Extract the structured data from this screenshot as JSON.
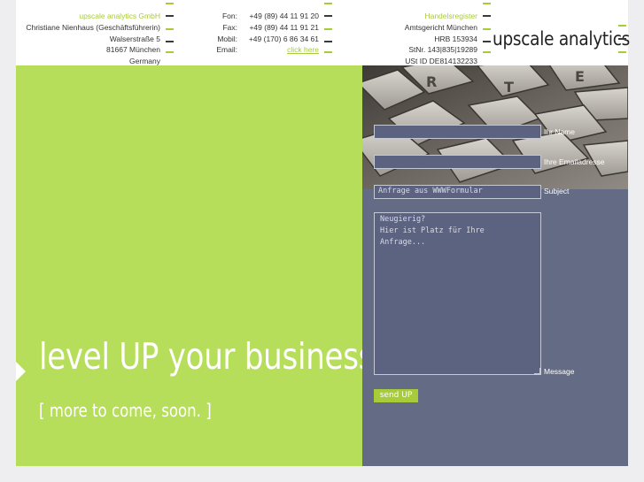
{
  "header": {
    "address": {
      "company": "upscale analytics GmbH",
      "person": "Christiane Nienhaus (Geschäftsführerin)",
      "street": "Walserstraße 5",
      "city": "81667 München",
      "country": "Germany"
    },
    "contact": {
      "labels": [
        "Fon:",
        "Fax:",
        "Mobil:",
        "Email:"
      ],
      "values": [
        "+49 (89) 44 11 91 20",
        "+49 (89) 44 11 91 21",
        "+49 (170) 6 86 34 61"
      ],
      "email_link": "click here"
    },
    "register": {
      "title": "Handelsregister",
      "court": "Amtsgericht München",
      "hrb": "HRB 153934",
      "tax_no": "StNr. 143|835|19289",
      "vat_id": "USt ID DE814132233"
    },
    "logo": "upscale analytics"
  },
  "hero": {
    "slogan": "level UP your business",
    "subslogan": "[ more to come, soon. ]"
  },
  "form": {
    "name_label": "Ihr Name",
    "email_label": "Ihre Emailadresse",
    "subject_label": "Subject",
    "subject_value": "Anfrage aus WWWFormular",
    "message_label": "Message",
    "message_value": "Neugierig?\nHier ist Platz für Ihre\nAnfrage...",
    "send_label": "send UP"
  },
  "colors": {
    "accent_green": "#a7cc3a",
    "hero_green": "#b7de5a",
    "form_bg": "#646b85"
  }
}
